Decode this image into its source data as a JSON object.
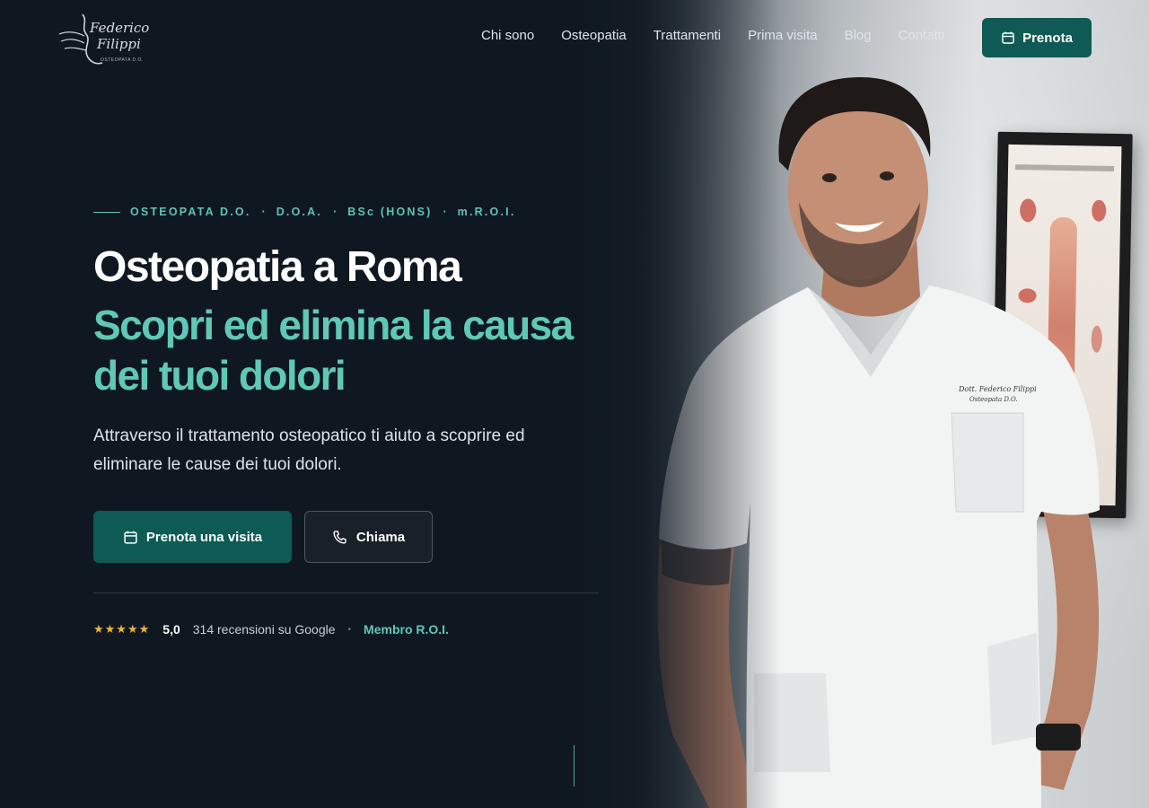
{
  "brand": {
    "logo_line1": "Federico",
    "logo_line2": "Filippi",
    "logo_tagline": "OSTEOPATA D.O."
  },
  "nav": {
    "items": [
      {
        "label": "Chi sono"
      },
      {
        "label": "Osteopatia"
      },
      {
        "label": "Trattamenti"
      },
      {
        "label": "Prima visita"
      },
      {
        "label": "Blog"
      },
      {
        "label": "Contatti"
      }
    ],
    "book_button": "Prenota"
  },
  "hero": {
    "credentials": [
      "OSTEOPATA D.O.",
      "D.O.A.",
      "BSc (HONS)",
      "m.R.O.I."
    ],
    "headline": "Osteopatia a Roma",
    "subheadline": "Scopri ed elimina la causa dei tuoi dolori",
    "intro": "Attraverso il trattamento osteopatico ti aiuto a scoprire ed eliminare le cause dei tuoi dolori.",
    "primary_button": "Prenota una visita",
    "secondary_button": "Chiama",
    "stars": "★★★★★",
    "rating": "5,0",
    "reviews": "314 recensioni su Google",
    "separator": "•",
    "member": "Membro R.O.I."
  },
  "photo": {
    "coat_embroidery_line1": "Dott. Federico Filippi",
    "coat_embroidery_line2": "Osteopata D.O."
  },
  "colors": {
    "background": "#0f1821",
    "accent": "#5fc8b6",
    "button": "#0e5a54",
    "star": "#f0b232"
  }
}
